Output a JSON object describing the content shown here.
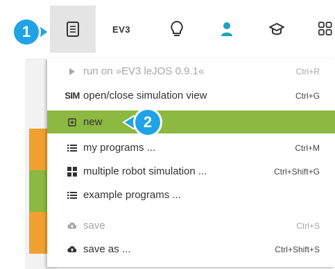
{
  "toolbar": {
    "ev3_label": "EV3",
    "items": [
      {
        "icon": "program-list-icon",
        "active": true
      },
      {
        "icon": "ev3-label"
      },
      {
        "icon": "lightbulb-icon"
      },
      {
        "icon": "user-icon",
        "color": "#1fa3b8"
      },
      {
        "icon": "graduation-cap-icon"
      },
      {
        "icon": "grid-icon"
      }
    ]
  },
  "menu": {
    "items": [
      {
        "icon": "play-icon",
        "label": "run on »EV3 leJOS 0.9.1«",
        "shortcut": "Ctrl+R",
        "disabled": true
      },
      {
        "icon": "sim-icon",
        "icon_text": "SIM",
        "label": "open/close simulation view",
        "shortcut": "Ctrl+G"
      },
      {
        "icon": "new-icon",
        "label": "new",
        "shortcut": "",
        "highlighted": true
      },
      {
        "icon": "list-icon",
        "label": "my programs ...",
        "shortcut": "Ctrl+M"
      },
      {
        "icon": "multi-robot-icon",
        "label": "multiple robot simulation ...",
        "shortcut": "Ctrl+Shift+G"
      },
      {
        "icon": "list-icon",
        "label": "example programs ...",
        "shortcut": ""
      },
      {
        "icon": "cloud-upload-icon",
        "label": "save",
        "shortcut": "Ctrl+S",
        "disabled": true
      },
      {
        "icon": "cloud-upload-icon",
        "label": "save as ...",
        "shortcut": "Ctrl+Shift+S"
      }
    ]
  },
  "badges": [
    "1",
    "2"
  ],
  "colors": {
    "highlight": "#8db842",
    "badge": "#1fa3e5",
    "user_icon": "#1fa3b8"
  }
}
